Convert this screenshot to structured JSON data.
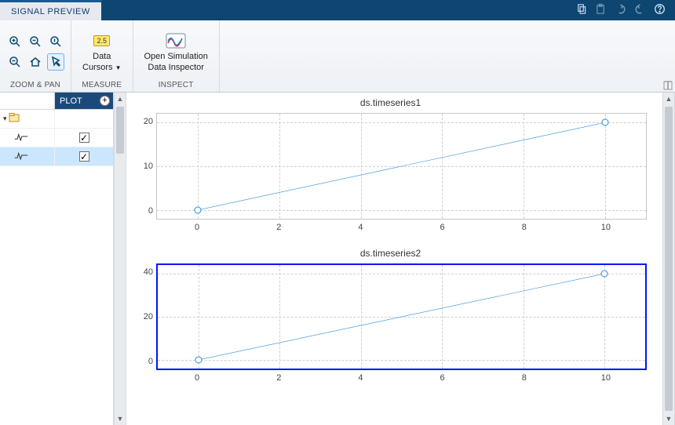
{
  "tab": {
    "label": "SIGNAL PREVIEW"
  },
  "ribbon": {
    "zoom_pan": "ZOOM & PAN",
    "measure": "MEASURE",
    "inspect": "INSPECT",
    "data_cursors": "Data\nCursors",
    "cursor_badge": "2.5",
    "sdi_line1": "Open Simulation",
    "sdi_line2": "Data Inspector"
  },
  "tree": {
    "header": "PLOT",
    "rows": [
      {
        "checked": true,
        "selected": false
      },
      {
        "checked": true,
        "selected": true
      }
    ]
  },
  "chart_data": [
    {
      "type": "line",
      "title": "ds.timeseries1",
      "x": [
        0,
        10
      ],
      "y": [
        0,
        20
      ],
      "xticks": [
        0,
        2,
        4,
        6,
        8,
        10
      ],
      "yticks": [
        0,
        10,
        20
      ],
      "xlim": [
        -1,
        11
      ],
      "ylim": [
        -2,
        22
      ],
      "selected": false
    },
    {
      "type": "line",
      "title": "ds.timeseries2",
      "x": [
        0,
        10
      ],
      "y": [
        0,
        40
      ],
      "xticks": [
        0,
        2,
        4,
        6,
        8,
        10
      ],
      "yticks": [
        0,
        20,
        40
      ],
      "xlim": [
        -1,
        11
      ],
      "ylim": [
        -4,
        44
      ],
      "selected": true
    }
  ]
}
